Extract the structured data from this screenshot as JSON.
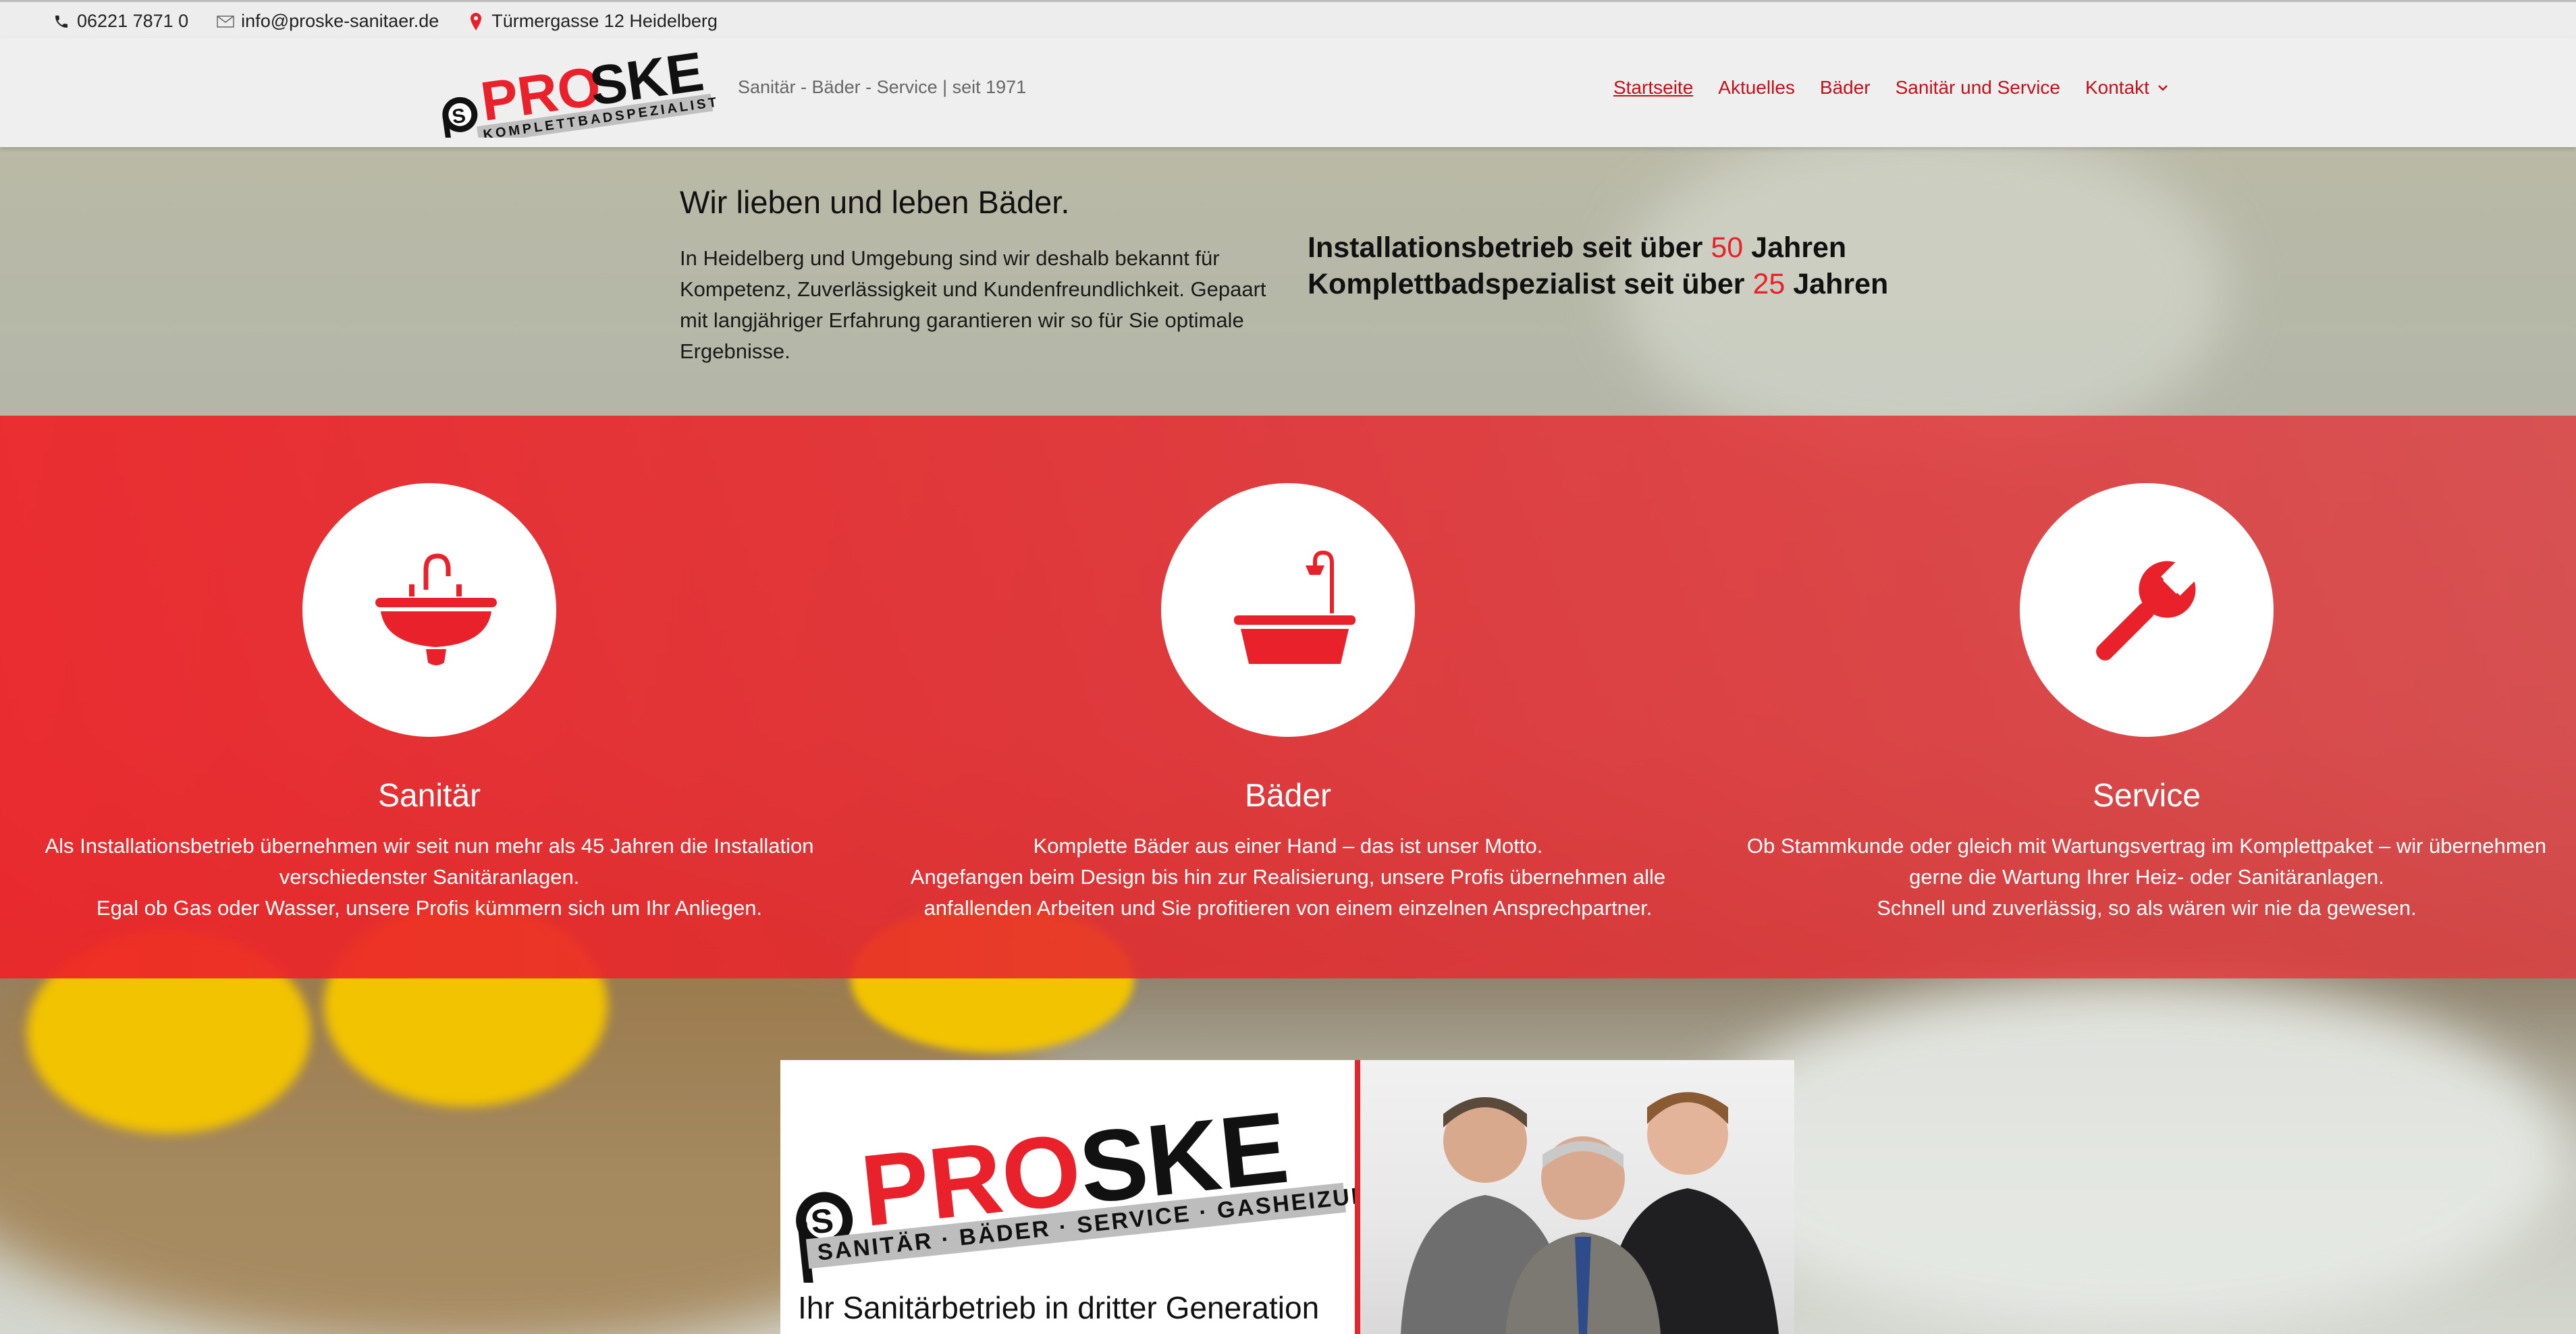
{
  "topbar": {
    "phone": "06221 7871 0",
    "email": "info@proske-sanitaer.de",
    "address": "Türmergasse 12 Heidelberg",
    "icons": [
      "phone-icon",
      "mail-icon",
      "pin-icon"
    ]
  },
  "header": {
    "logo_main_pro": "PRO",
    "logo_main_ske": "SKE",
    "logo_sub": "KOMPLETTBADSPEZIALIST",
    "tagline": "Sanitär - Bäder - Service | seit 1971",
    "nav": [
      {
        "label": "Startseite",
        "active": true
      },
      {
        "label": "Aktuelles"
      },
      {
        "label": "Bäder"
      },
      {
        "label": "Sanitär und Service"
      },
      {
        "label": "Kontakt",
        "dropdown": true
      }
    ]
  },
  "intro": {
    "title": "Wir lieben und leben Bäder.",
    "text": "In Heidelberg und Umgebung sind wir deshalb bekannt für Kompetenz, Zuverlässigkeit und Kundenfreundlichkeit. Gepaart mit langjähriger Erfahrung garantieren wir so für Sie optimale Ergebnisse.",
    "years": [
      {
        "before": "Installationsbetrieb seit über ",
        "number": "50",
        "after": " Jahren"
      },
      {
        "before": "Komplettbadspezialist seit über ",
        "number": "25",
        "after": " Jahren"
      }
    ]
  },
  "services": [
    {
      "icon": "sink-icon",
      "title": "Sanitär",
      "text": "Als Installationsbetrieb übernehmen wir seit nun mehr als 45 Jahren die Installation verschiedenster Sanitäranlagen.\nEgal ob Gas oder Wasser, unsere Profis kümmern sich um Ihr Anliegen."
    },
    {
      "icon": "bathtub-icon",
      "title": "Bäder",
      "text": "Komplette Bäder aus einer Hand – das ist unser Motto.\nAngefangen beim Design bis hin zur Realisierung, unsere Profis übernehmen alle anfallenden Arbeiten und Sie profitieren von einem einzelnen Ansprechpartner."
    },
    {
      "icon": "wrench-icon",
      "title": "Service",
      "text": "Ob Stammkunde oder gleich mit Wartungsvertrag im Komplettpaket – wir übernehmen gerne die Wartung Ihrer Heiz- oder Sanitäranlagen.\nSchnell und zuverlässig, so als wären wir nie da gewesen."
    }
  ],
  "banner": {
    "logo_pro": "PRO",
    "logo_ske": "SKE",
    "logo_sub": "SANITÄR · BÄDER · SERVICE · GASHEIZUNG",
    "slogan": "Ihr Sanitärbetrieb in dritter Generation"
  },
  "colors": {
    "brand_red": "#e8212b",
    "nav_red": "#c4101a",
    "band_red": "#ee2328"
  }
}
